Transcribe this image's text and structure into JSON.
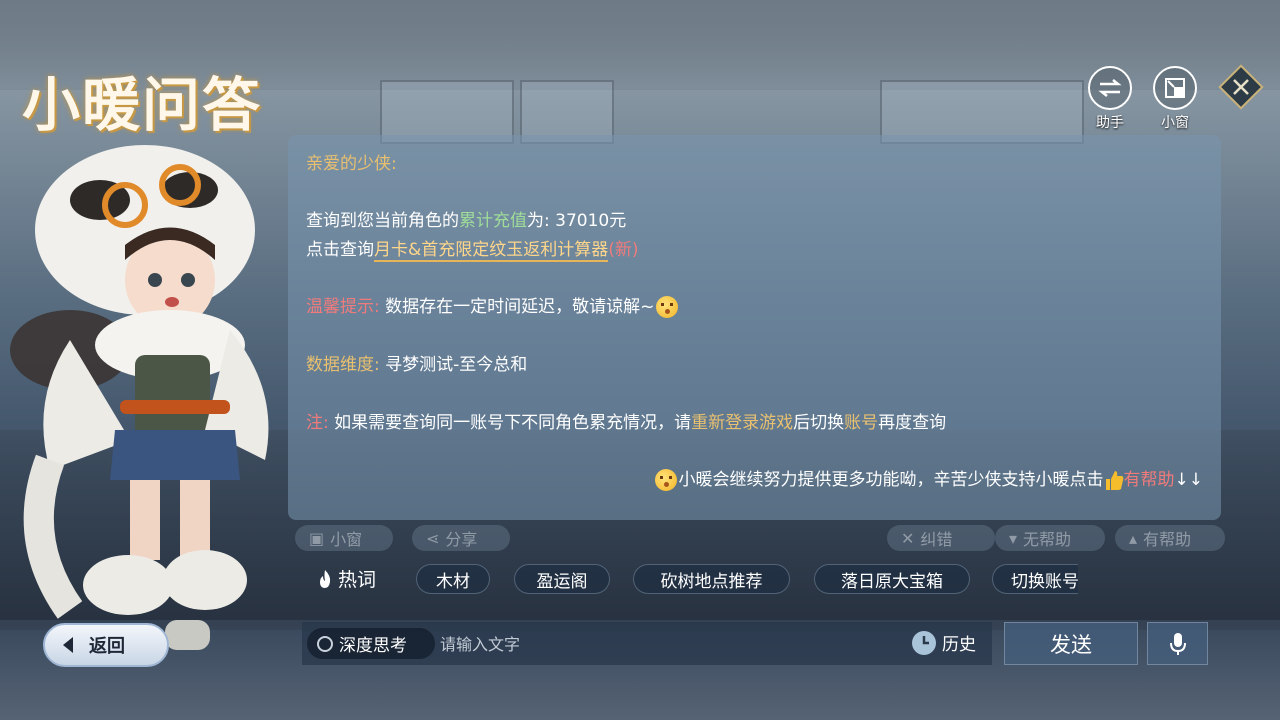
{
  "header": {
    "logo_text": "小暖问答",
    "assistant_label": "助手",
    "mini_window_label": "小窗"
  },
  "message": {
    "greeting": "亲爱的少侠:",
    "query_prefix": "查询到您当前角色的",
    "recharge_term": "累计充值",
    "query_suffix": "为: 37010元",
    "click_prefix": "点击查询",
    "calculator_link": "月卡&首充限定纹玉返利计算器",
    "new_tag": "(新)",
    "tip_label": "温馨提示:",
    "tip_text": "数据存在一定时间延迟，敬请谅解~",
    "dimension_label": "数据维度:",
    "dimension_value": "寻梦测试-至今总和",
    "note_label": "注:",
    "note_text_a": "如果需要查询同一账号下不同角色累充情况，请",
    "note_relogin": "重新登录游戏",
    "note_text_b": "后切换",
    "note_account": "账号",
    "note_text_c": "再度查询",
    "footer_text": "小暖会继续努力提供更多功能呦，辛苦少侠支持小暖点击",
    "footer_helpful": "有帮助",
    "footer_arrows": "↓↓"
  },
  "actions": {
    "mini_window": "小窗",
    "share": "分享",
    "report_error": "纠错",
    "not_helpful": "无帮助",
    "helpful": "有帮助"
  },
  "hotwords": {
    "label": "热词",
    "items": [
      "木材",
      "盈运阁",
      "砍树地点推荐",
      "落日原大宝箱",
      "切换账号"
    ]
  },
  "bottom": {
    "back_label": "返回",
    "deep_think_label": "深度思考",
    "input_placeholder": "请输入文字",
    "history_label": "历史",
    "send_label": "发送"
  },
  "colors": {
    "accent_gold": "#e8c070",
    "accent_green": "#9fdc9a",
    "accent_red": "#f07b7b",
    "panel_bg": "#7896af"
  }
}
